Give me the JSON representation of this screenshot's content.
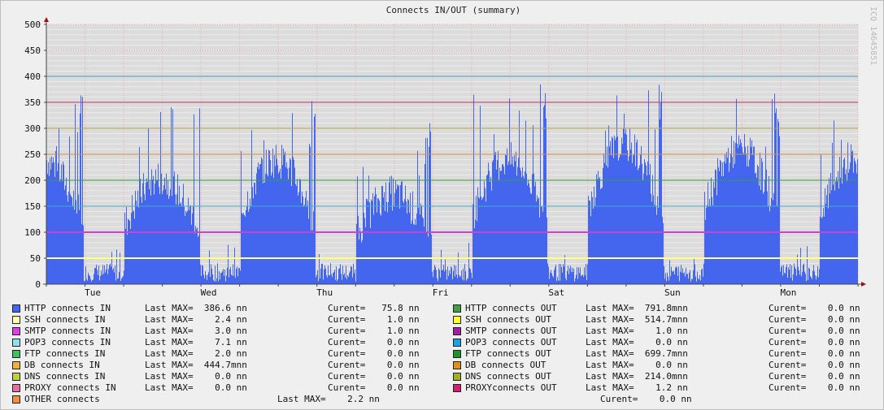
{
  "header": {
    "title": "Connects IN/OUT (summary)",
    "watermark": "ICQ 14645851"
  },
  "chart_data": {
    "type": "bar",
    "title": "Connects IN/OUT (summary)",
    "ylim": [
      0,
      500
    ],
    "y_ticks": [
      0,
      50,
      100,
      150,
      200,
      250,
      300,
      350,
      400,
      450,
      500
    ],
    "x_ticks": [
      "Tue",
      "Wed",
      "Thu",
      "Fri",
      "Sat",
      "Sun",
      "Mon"
    ],
    "grid": true,
    "threshold_lines": [
      {
        "value": 400,
        "color": "#3c9fc0"
      },
      {
        "value": 350,
        "color": "#c0306a"
      },
      {
        "value": 300,
        "color": "#b8a840"
      },
      {
        "value": 250,
        "color": "#d89040"
      },
      {
        "value": 200,
        "color": "#30a040"
      },
      {
        "value": 150,
        "color": "#40b0c8"
      },
      {
        "value": 100,
        "color": "#c030c0"
      },
      {
        "value": 50,
        "color": "#e8e800"
      }
    ],
    "series": [
      {
        "name": "HTTP connects IN",
        "color": "#4466ee",
        "days": [
          {
            "peak": 375,
            "base": 240
          },
          {
            "peak": 360,
            "base": 205
          },
          {
            "peak": 380,
            "base": 240
          },
          {
            "peak": 313,
            "base": 175
          },
          {
            "peak": 386,
            "base": 240
          },
          {
            "peak": 385,
            "base": 270
          },
          {
            "peak": 370,
            "base": 260
          }
        ],
        "night_min": 5,
        "current": 75.8
      },
      {
        "name": "SSH connects IN",
        "color": "#ffff80",
        "level": 50
      },
      {
        "name": "SMTP connects IN",
        "color": "#d040d0",
        "level": 100
      }
    ]
  },
  "legend": {
    "rows": [
      {
        "in_color": "#4466ee",
        "in_label": "HTTP connects IN",
        "in_max": "Last MAX=  386.6 nn",
        "in_cur": "Curent=   75.8 nn",
        "out_color": "#40a040",
        "out_label": "HTTP connects OUT",
        "out_max": "Last MAX=  791.8mnn",
        "out_cur": "Curent=    0.0 nn"
      },
      {
        "in_color": "#ffffb0",
        "in_label": "SSH connects IN",
        "in_max": "Last MAX=    2.4 nn",
        "in_cur": "Curent=    1.0 nn",
        "out_color": "#ffff30",
        "out_label": "SSH connects OUT",
        "out_max": "Last MAX=  514.7mnn",
        "out_cur": "Curent=    0.0 nn"
      },
      {
        "in_color": "#e040e0",
        "in_label": "SMTP connects IN",
        "in_max": "Last MAX=    3.0 nn",
        "in_cur": "Curent=    1.0 nn",
        "out_color": "#a020a0",
        "out_label": "SMTP connects OUT",
        "out_max": "Last MAX=    1.0 nn",
        "out_cur": "Curent=    0.0 nn"
      },
      {
        "in_color": "#90e0f0",
        "in_label": "POP3 connects IN",
        "in_max": "Last MAX=    7.1 nn",
        "in_cur": "Curent=    0.0 nn",
        "out_color": "#20a0e0",
        "out_label": "POP3 connects OUT",
        "out_max": "Last MAX=    0.0 nn",
        "out_cur": "Curent=    0.0 nn"
      },
      {
        "in_color": "#40c060",
        "in_label": "FTP connects IN",
        "in_max": "Last MAX=    2.0 nn",
        "in_cur": "Curent=    0.0 nn",
        "out_color": "#209030",
        "out_label": "FTP connects OUT",
        "out_max": "Last MAX=  699.7mnn",
        "out_cur": "Curent=    0.0 nn"
      },
      {
        "in_color": "#f0b040",
        "in_label": "DB connects IN",
        "in_max": "Last MAX=  444.7mnn",
        "in_cur": "Curent=    0.0 nn",
        "out_color": "#e09020",
        "out_label": "DB connects OUT",
        "out_max": "Last MAX=    0.0 nn",
        "out_cur": "Curent=    0.0 nn"
      },
      {
        "in_color": "#c0d040",
        "in_label": "DNS connects IN",
        "in_max": "Last MAX=    0.0 nn",
        "in_cur": "Curent=    0.0 nn",
        "out_color": "#a0b020",
        "out_label": "DNS connects OUT",
        "out_max": "Last MAX=  214.0mnn",
        "out_cur": "Curent=    0.0 nn"
      },
      {
        "in_color": "#e070a0",
        "in_label": "PROXY connects IN",
        "in_max": "Last MAX=    0.0 nn",
        "in_cur": "Curent=    0.0 nn",
        "out_color": "#d02070",
        "out_label": "PROXYconnects OUT",
        "out_max": "Last MAX=    1.2 nn",
        "out_cur": "Curent=    0.0 nn"
      }
    ],
    "other": {
      "color": "#f09040",
      "label": "OTHER connects",
      "max": "Last MAX=    2.2 nn",
      "cur": "Curent=    0.0 nn"
    }
  }
}
